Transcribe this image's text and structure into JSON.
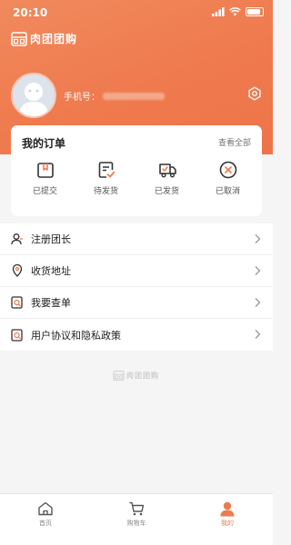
{
  "status": {
    "time": "20:10"
  },
  "brand": {
    "name": "肉团团购"
  },
  "profile": {
    "phone_label": "手机号："
  },
  "orders": {
    "title": "我的订单",
    "view_all": "查看全部",
    "items": [
      {
        "label": "已提交",
        "icon": "submitted-icon"
      },
      {
        "label": "待发货",
        "icon": "pending-shipment-icon"
      },
      {
        "label": "已发货",
        "icon": "shipped-icon"
      },
      {
        "label": "已取消",
        "icon": "cancelled-icon"
      }
    ]
  },
  "menu": {
    "items": [
      {
        "label": "注册团长",
        "icon": "user-icon"
      },
      {
        "label": "收货地址",
        "icon": "location-icon"
      },
      {
        "label": "我要查单",
        "icon": "search-order-icon"
      },
      {
        "label": "用户协议和隐私政策",
        "icon": "agreement-icon"
      }
    ]
  },
  "footer": {
    "logo_text": "肉团团购"
  },
  "tabbar": {
    "items": [
      {
        "label": "首页",
        "icon": "home-icon",
        "active": false
      },
      {
        "label": "购物车",
        "icon": "cart-icon",
        "active": false
      },
      {
        "label": "我的",
        "icon": "profile-icon",
        "active": true
      }
    ]
  },
  "colors": {
    "accent": "#ef7a4e",
    "icon_dark": "#333333"
  }
}
